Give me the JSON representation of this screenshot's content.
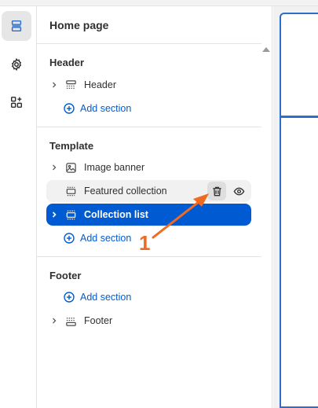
{
  "panel": {
    "title": "Home page"
  },
  "groups": {
    "header": {
      "title": "Header",
      "items": [
        {
          "label": "Header"
        }
      ],
      "add_label": "Add section"
    },
    "template": {
      "title": "Template",
      "items": [
        {
          "label": "Image banner"
        },
        {
          "label": "Featured collection"
        },
        {
          "label": "Collection list"
        }
      ],
      "add_label": "Add section"
    },
    "footer": {
      "title": "Footer",
      "add_label": "Add section",
      "items": [
        {
          "label": "Footer"
        }
      ]
    }
  },
  "annotation": {
    "step_number": "1",
    "color": "#f06a1f"
  },
  "colors": {
    "accent": "#005bd3",
    "selected_text": "#ffffff",
    "annotation": "#f06a1f"
  },
  "icons": {
    "rail": [
      "sections-icon",
      "gear-icon",
      "apps-icon"
    ],
    "row_actions": [
      "trash-icon",
      "eye-icon"
    ]
  }
}
